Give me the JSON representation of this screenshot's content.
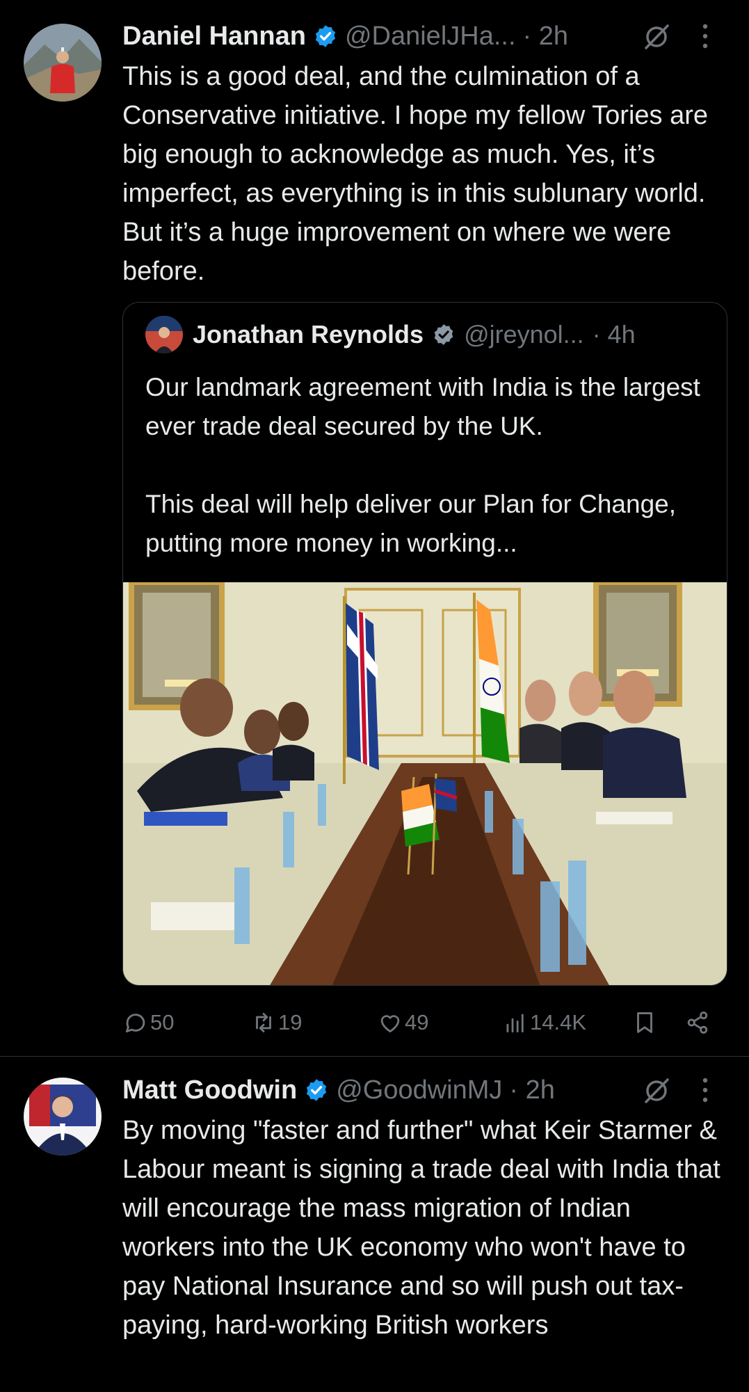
{
  "tweets": [
    {
      "author_name": "Daniel Hannan",
      "handle": "@DanielJHa...",
      "time": "· 2h",
      "text": "This is a good deal, and the culmination of a Conservative initiative. I hope my fellow Tories are big enough to acknowledge as much. Yes, it’s imperfect, as everything is in this sublunary world. But it’s a huge improvement on where we were before.",
      "quote": {
        "author_name": "Jonathan Reynolds",
        "handle": "@jreynol...",
        "time": "· 4h",
        "text": "Our landmark agreement with India is the largest ever trade deal secured by the UK.\n\nThis deal will help deliver our Plan for Change, putting more money in working..."
      },
      "stats": {
        "replies": "50",
        "reposts": "19",
        "likes": "49",
        "views": "14.4K"
      }
    },
    {
      "author_name": "Matt Goodwin",
      "handle": "@GoodwinMJ",
      "time": "· 2h",
      "text": "By moving \"faster and further\" what Keir Starmer & Labour meant is signing a trade deal with India that will encourage the mass migration of Indian workers into the UK economy who won't have to pay National Insurance and so will push out tax-paying, hard-working British workers"
    }
  ],
  "icons": {
    "verified": "verified-badge-icon",
    "grok": "grok-icon",
    "more": "more-vertical-icon",
    "reply": "reply-icon",
    "repost": "repost-icon",
    "like": "like-icon",
    "views": "views-icon",
    "bookmark": "bookmark-icon",
    "share": "share-icon"
  },
  "colors": {
    "background": "#000000",
    "text": "#e7e9ea",
    "secondary": "#71767b",
    "verified": "#1d9bf0",
    "border": "#2f3336"
  }
}
